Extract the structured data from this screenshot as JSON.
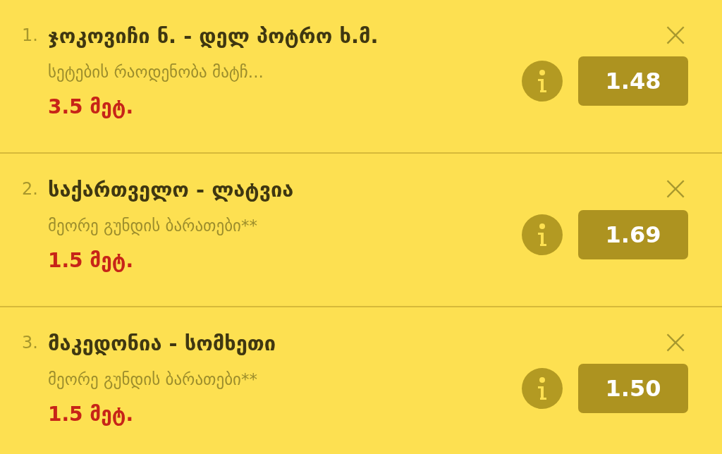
{
  "bets": [
    {
      "index": "1.",
      "title": "ჯოკოვიჩი ნ. - დელ პოტრო ხ.მ.",
      "market": "სეტების რაოდენობა მატჩ...",
      "pick": "3.5 მეტ.",
      "odds": "1.48",
      "remove": "×"
    },
    {
      "index": "2.",
      "title": "საქართველო - ლატვია",
      "market": "მეორე გუნდის ბარათები**",
      "pick": "1.5 მეტ.",
      "odds": "1.69",
      "remove": "×"
    },
    {
      "index": "3.",
      "title": "მაკედონია - სომხეთი",
      "market": "მეორე გუნდის ბარათები**",
      "pick": "1.5 მეტ.",
      "odds": "1.50",
      "remove": "×"
    }
  ]
}
